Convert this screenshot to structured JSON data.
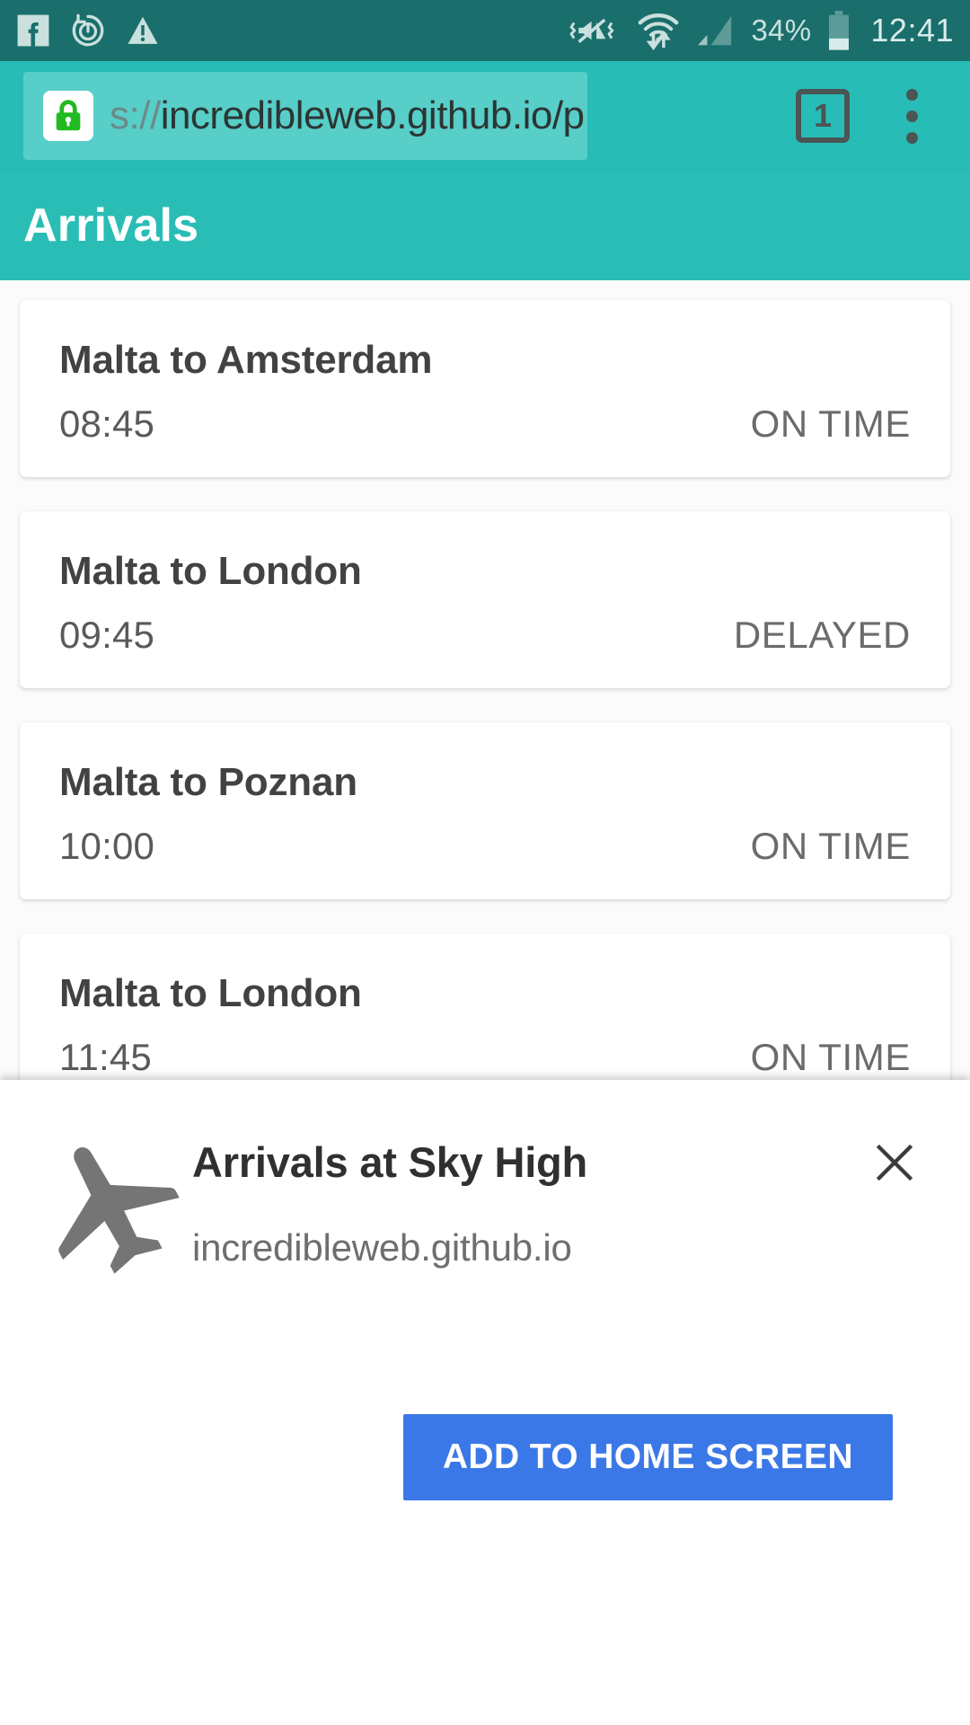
{
  "status_bar": {
    "icons_left": [
      "facebook-icon",
      "sync-power-icon",
      "warning-triangle-icon"
    ],
    "icons_right": [
      "vibrate-mute-icon",
      "wifi-data-transfer-icon",
      "cellular-signal-icon"
    ],
    "battery_percent": "34%",
    "clock": "12:41"
  },
  "browser": {
    "lock_icon": "secure-lock-icon",
    "url_scheme": "s://",
    "url_host": "incredibleweb.github.io/p",
    "tab_count": "1",
    "menu_icon": "overflow-menu-icon"
  },
  "app": {
    "title": "Arrivals"
  },
  "flights": [
    {
      "route": "Malta to Amsterdam",
      "time": "08:45",
      "status": "ON TIME"
    },
    {
      "route": "Malta to London",
      "time": "09:45",
      "status": "DELAYED"
    },
    {
      "route": "Malta to Poznan",
      "time": "10:00",
      "status": "ON TIME"
    },
    {
      "route": "Malta to London",
      "time": "11:45",
      "status": "ON TIME"
    }
  ],
  "install_banner": {
    "icon": "airplane-icon",
    "title": "Arrivals at Sky High",
    "subtitle": "incredibleweb.github.io",
    "close_icon": "close-icon",
    "add_button": "ADD TO HOME SCREEN"
  },
  "colors": {
    "status_bar_bg": "#1a6e6b",
    "browser_bg": "#27bdb6",
    "app_header_bg": "#29bdb5",
    "omnibox_bg": "#57cec8",
    "lock_green": "#21ba21",
    "button_blue": "#3b78e7",
    "page_bg": "#fbfbfb"
  }
}
